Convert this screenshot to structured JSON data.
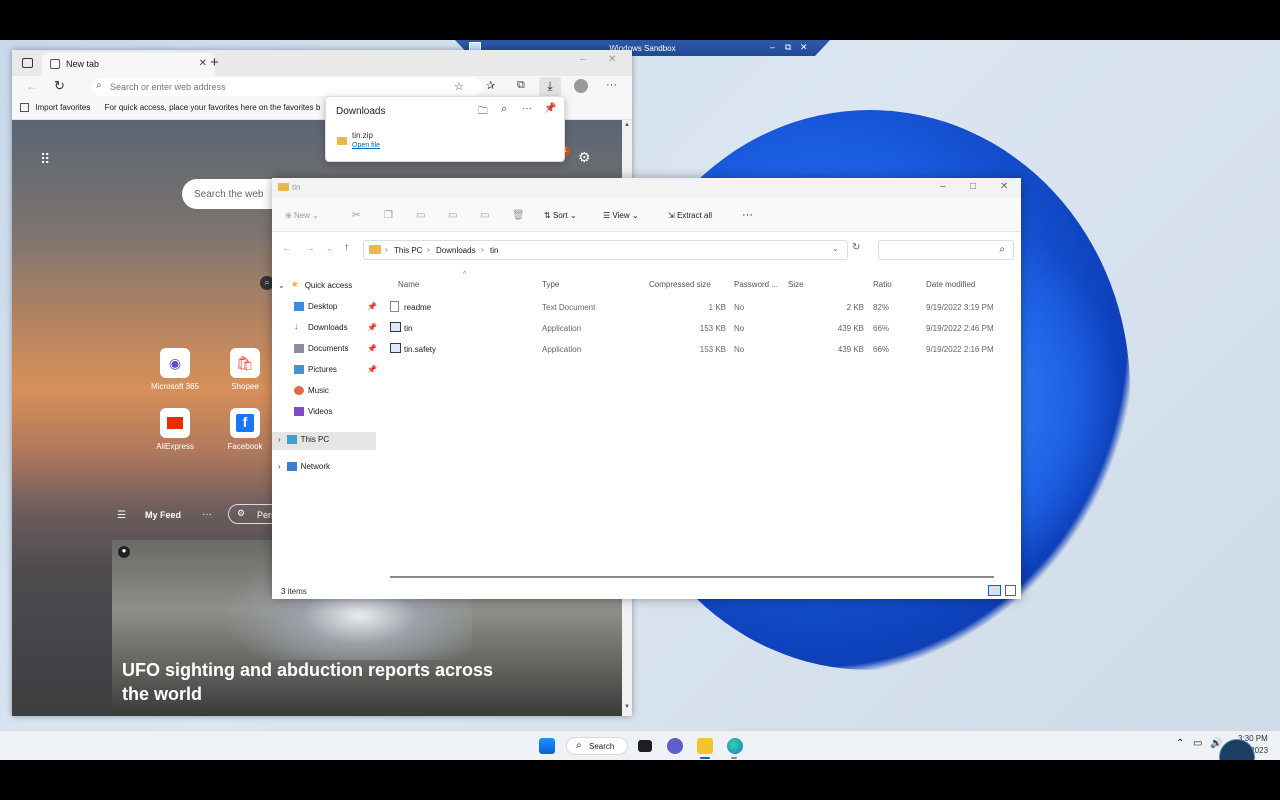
{
  "sandbox": {
    "title": "Windows Sandbox",
    "minimize": "‒",
    "restore": "⧉",
    "close": "✕"
  },
  "edge": {
    "tab_label": "New tab",
    "new_tab_plus": "+",
    "address_placeholder": "Search or enter web address",
    "import_favorites": "Import favorites",
    "favorites_hint": "For quick access, place your favorites here on the favorites b",
    "search_web_placeholder": "Search the web",
    "tiles": [
      {
        "label": "Microsoft 365",
        "icon": "microsoft-365-icon"
      },
      {
        "label": "Shopee",
        "icon": "shopee-icon"
      },
      {
        "label": "AliExpress",
        "icon": "aliexpress-icon"
      },
      {
        "label": "Facebook",
        "icon": "facebook-icon"
      }
    ],
    "feed_label": "My Feed",
    "feed_more": "···",
    "personalize": "Pers",
    "headline": "UFO sighting and abduction reports across the world",
    "notification_count": "1"
  },
  "downloads": {
    "title": "Downloads",
    "file_name": "tin.zip",
    "open_file": "Open file"
  },
  "explorer": {
    "window_title": "tin",
    "toolbar": {
      "new": "New",
      "sort": "Sort",
      "view": "View",
      "extract_all": "Extract all",
      "more": "···"
    },
    "breadcrumb": [
      "This PC",
      "Downloads",
      "tin"
    ],
    "nav": {
      "quick_access": "Quick access",
      "items": [
        "Desktop",
        "Downloads",
        "Documents",
        "Pictures",
        "Music",
        "Videos"
      ],
      "this_pc": "This PC",
      "network": "Network"
    },
    "columns": [
      "Name",
      "Type",
      "Compressed size",
      "Password ...",
      "Size",
      "Ratio",
      "Date modified"
    ],
    "rows": [
      {
        "name": "readme",
        "type": "Text Document",
        "compressed": "1 KB",
        "password": "No",
        "size": "2 KB",
        "ratio": "82%",
        "date": "9/19/2022 3:19 PM"
      },
      {
        "name": "tin",
        "type": "Application",
        "compressed": "153 KB",
        "password": "No",
        "size": "439 KB",
        "ratio": "66%",
        "date": "9/19/2022 2:46 PM"
      },
      {
        "name": "tin.safety",
        "type": "Application",
        "compressed": "153 KB",
        "password": "No",
        "size": "439 KB",
        "ratio": "66%",
        "date": "9/19/2022 2:16 PM"
      }
    ],
    "status": "3 items"
  },
  "taskbar": {
    "search_label": "Search",
    "time": "3:30 PM",
    "date": "/2023"
  },
  "colors": {
    "accent": "#0067c0",
    "bloom": "#1a5ce0",
    "sandbox_bar": "#2454a3"
  }
}
